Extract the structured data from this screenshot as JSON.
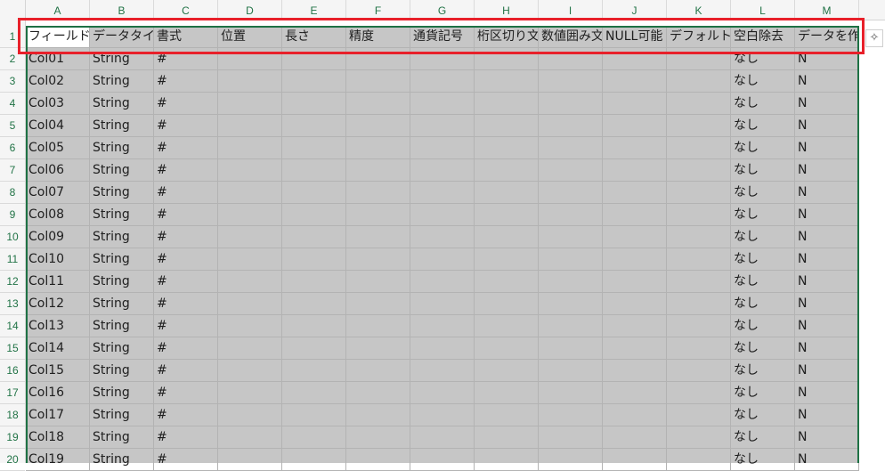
{
  "columns": [
    "A",
    "B",
    "C",
    "D",
    "E",
    "F",
    "G",
    "H",
    "I",
    "J",
    "K",
    "L",
    "M"
  ],
  "rows": [
    "1",
    "2",
    "3",
    "4",
    "5",
    "6",
    "7",
    "8",
    "9",
    "10",
    "11",
    "12",
    "13",
    "14",
    "15",
    "16",
    "17",
    "18",
    "19",
    "20"
  ],
  "header_cells": [
    "フィールド名",
    "データタイプ",
    "書式",
    "位置",
    "長さ",
    "精度",
    "通貨記号",
    "桁区切り文字",
    "数値囲み文字",
    "NULL可能",
    "デフォルト値",
    "空白除去",
    "データを作成"
  ],
  "data_rows": [
    [
      "Col01",
      "String",
      "#",
      "",
      "",
      "",
      "",
      "",
      "",
      "",
      "",
      "なし",
      "N"
    ],
    [
      "Col02",
      "String",
      "#",
      "",
      "",
      "",
      "",
      "",
      "",
      "",
      "",
      "なし",
      "N"
    ],
    [
      "Col03",
      "String",
      "#",
      "",
      "",
      "",
      "",
      "",
      "",
      "",
      "",
      "なし",
      "N"
    ],
    [
      "Col04",
      "String",
      "#",
      "",
      "",
      "",
      "",
      "",
      "",
      "",
      "",
      "なし",
      "N"
    ],
    [
      "Col05",
      "String",
      "#",
      "",
      "",
      "",
      "",
      "",
      "",
      "",
      "",
      "なし",
      "N"
    ],
    [
      "Col06",
      "String",
      "#",
      "",
      "",
      "",
      "",
      "",
      "",
      "",
      "",
      "なし",
      "N"
    ],
    [
      "Col07",
      "String",
      "#",
      "",
      "",
      "",
      "",
      "",
      "",
      "",
      "",
      "なし",
      "N"
    ],
    [
      "Col08",
      "String",
      "#",
      "",
      "",
      "",
      "",
      "",
      "",
      "",
      "",
      "なし",
      "N"
    ],
    [
      "Col09",
      "String",
      "#",
      "",
      "",
      "",
      "",
      "",
      "",
      "",
      "",
      "なし",
      "N"
    ],
    [
      "Col10",
      "String",
      "#",
      "",
      "",
      "",
      "",
      "",
      "",
      "",
      "",
      "なし",
      "N"
    ],
    [
      "Col11",
      "String",
      "#",
      "",
      "",
      "",
      "",
      "",
      "",
      "",
      "",
      "なし",
      "N"
    ],
    [
      "Col12",
      "String",
      "#",
      "",
      "",
      "",
      "",
      "",
      "",
      "",
      "",
      "なし",
      "N"
    ],
    [
      "Col13",
      "String",
      "#",
      "",
      "",
      "",
      "",
      "",
      "",
      "",
      "",
      "なし",
      "N"
    ],
    [
      "Col14",
      "String",
      "#",
      "",
      "",
      "",
      "",
      "",
      "",
      "",
      "",
      "なし",
      "N"
    ],
    [
      "Col15",
      "String",
      "#",
      "",
      "",
      "",
      "",
      "",
      "",
      "",
      "",
      "なし",
      "N"
    ],
    [
      "Col16",
      "String",
      "#",
      "",
      "",
      "",
      "",
      "",
      "",
      "",
      "",
      "なし",
      "N"
    ],
    [
      "Col17",
      "String",
      "#",
      "",
      "",
      "",
      "",
      "",
      "",
      "",
      "",
      "なし",
      "N"
    ],
    [
      "Col18",
      "String",
      "#",
      "",
      "",
      "",
      "",
      "",
      "",
      "",
      "",
      "なし",
      "N"
    ],
    [
      "Col19",
      "String",
      "#",
      "",
      "",
      "",
      "",
      "",
      "",
      "",
      "",
      "なし",
      "N"
    ]
  ],
  "icons": {
    "quick_analysis": "quick-analysis-icon",
    "quick_analysis_glyph": "✧"
  },
  "colors": {
    "highlight": "#e8202a",
    "selection_fill": "#c6c6c6",
    "selection_border": "#1e7145",
    "header_text": "#217346"
  }
}
